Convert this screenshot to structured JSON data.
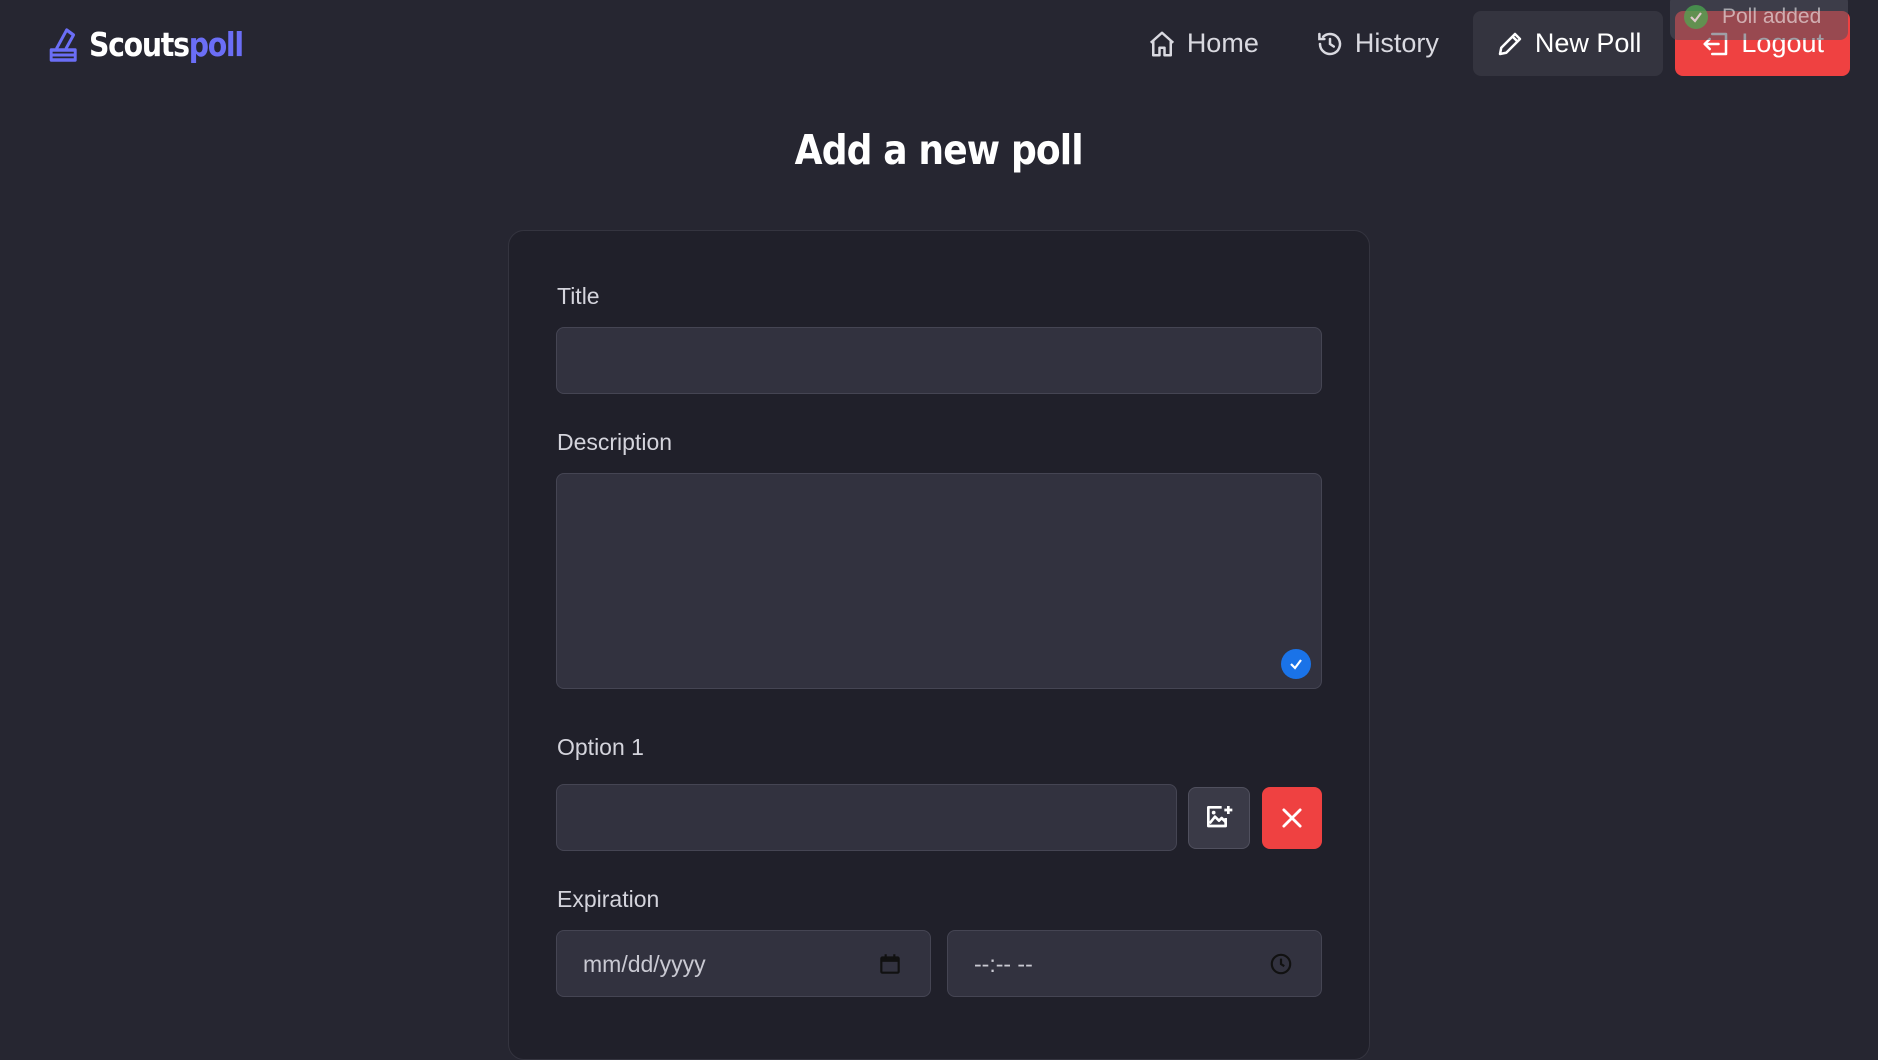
{
  "brand": {
    "part1": "Scouts",
    "part2": "poll",
    "logo_icon": "ballot-box-icon"
  },
  "nav": {
    "home": "Home",
    "history": "History",
    "new_poll": "New Poll",
    "logout": "Logout"
  },
  "toast": {
    "message": "Poll added",
    "icon": "check-circle-icon"
  },
  "page": {
    "title": "Add a new poll"
  },
  "form": {
    "title_label": "Title",
    "title_value": "",
    "description_label": "Description",
    "description_value": "",
    "option_label": "Option 1",
    "option_value": "",
    "expiration_label": "Expiration",
    "date_placeholder": "mm/dd/yyyy",
    "time_placeholder": "--:-- --"
  },
  "colors": {
    "background": "#262631",
    "card": "#20202a",
    "input": "#32323f",
    "accent": "#6b6ef6",
    "danger": "#ef4141",
    "badge": "#1a73e8"
  }
}
